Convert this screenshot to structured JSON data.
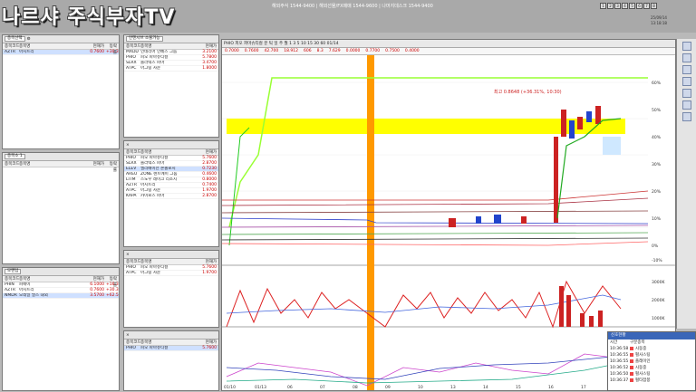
{
  "brand": "나르샤 주식부자TV",
  "ticker": "해외주식 1544-9400 | 해외선물/FX매매 1544-9600 | 나머지데스크 1544-9400",
  "window_buttons": [
    "1",
    "2",
    "3",
    "4",
    "5",
    "6",
    "7",
    "8"
  ],
  "clock": {
    "date": "25/09/14",
    "time": "13:18:18"
  },
  "panel1": {
    "code": "종목선택",
    "cols": [
      "종목코드",
      "종목명",
      "현재가",
      "등락률"
    ],
    "rows": [
      {
        "code": "AZTR",
        "name": "아지트리",
        "price": "0.7600",
        "chg": "+30.3"
      }
    ]
  },
  "panel2": {
    "code": "인텐시브 소울가능",
    "cols": [
      "종목코드",
      "종목명",
      "현재가"
    ],
    "rows": [
      {
        "code": "MXDD",
        "name": "인테리어 인베스 그룹",
        "price": "3.2100"
      },
      {
        "code": "PHIO",
        "name": "피오 파마슈티컬",
        "price": "5.7800"
      },
      {
        "code": "SLRX",
        "name": "솔라텍스 파마",
        "price": "3.4700"
      },
      {
        "code": "ATPC",
        "name": "아그링 사운",
        "price": "1.8000"
      }
    ]
  },
  "panel3": {
    "code": "종목소 1",
    "cols": [
      "종목코드",
      "종목명",
      "현재가",
      "등락률"
    ],
    "rows": []
  },
  "panel4": {
    "cols": [
      "종목코드",
      "종목명",
      "현재가"
    ],
    "rows": [
      {
        "code": "PHIO",
        "name": "피오 파마슈티컬",
        "price": "5.7600"
      },
      {
        "code": "SLRX",
        "name": "솔라텍스 파마",
        "price": "2.8700"
      },
      {
        "code": "ELEV",
        "name": "엘리베이션 온콜로지",
        "price": "0.7230"
      },
      {
        "code": "AREU",
        "name": "ZONE 렌트에이 그룹",
        "price": "0.4600"
      },
      {
        "code": "LITM",
        "name": "스노우 레이크 리소시",
        "price": "0.8000"
      },
      {
        "code": "AZTR",
        "name": "아지트리",
        "price": "0.7400"
      },
      {
        "code": "ATPC",
        "name": "아그링 사운",
        "price": "1.9700"
      },
      {
        "code": "KAPA",
        "name": "카이로스 파마",
        "price": "2.8700"
      }
    ]
  },
  "panel5": {
    "code": "모멘텀",
    "cols": [
      "종목코드",
      "종목명",
      "현재가",
      "등락률"
    ],
    "rows": [
      {
        "code": "PHIN",
        "name": "피에이",
        "price": "6.1000",
        "chg": "+16.3"
      },
      {
        "code": "AZTR",
        "name": "아지트리",
        "price": "0.7600",
        "chg": "+30.3"
      },
      {
        "code": "NMDR",
        "name": "오레일 멀스 내외",
        "price": "3.5700",
        "chg": "+62.5"
      }
    ]
  },
  "panel6": {
    "cols": [
      "종목코드",
      "종목명",
      "현재가"
    ],
    "rows": [
      {
        "code": "PHIO",
        "name": "피오 파마슈티컬",
        "price": "5.7600"
      },
      {
        "code": "ATPC",
        "name": "아그링 사운",
        "price": "1.9700"
      }
    ]
  },
  "panel7": {
    "cols": [
      "종목코드",
      "종목명",
      "현재가"
    ],
    "rows": [
      {
        "code": "PHIO",
        "name": "피오 파마슈티컬",
        "price": "5.7600"
      }
    ]
  },
  "chart": {
    "symbol": "PHIO",
    "toolbar": "PHIO 피오 파마슈티컬  분 틱 일 주 월  1 3 5 10 15 30 60  01/14",
    "info": [
      "0.7000",
      "0.7600",
      "42.700",
      "18.912",
      "606",
      "8.3",
      "7.629",
      "0.0000",
      "0.7700",
      "0.7500",
      "0.4000"
    ],
    "peak_label": "최고 0.8648 (+36.31%, 10:30)",
    "axis_pct": [
      "60%",
      "50%",
      "40%",
      "30%",
      "20%",
      "10%",
      "0%",
      "-10%"
    ],
    "vol_axis": [
      "3000K",
      "2000K",
      "1000K"
    ],
    "dates": [
      "01/10",
      "01/13",
      "06",
      "07",
      "08",
      "09",
      "10",
      "13",
      "14",
      "15",
      "16",
      "17",
      "20"
    ]
  },
  "signal": {
    "title": "신호현황",
    "cols": [
      "시간",
      "구분",
      "종목"
    ],
    "rows": [
      {
        "time": "10:36:58",
        "name": "시동중"
      },
      {
        "time": "10:36:55",
        "name": "펄사스팅"
      },
      {
        "time": "10:36:55",
        "name": "플레이인"
      },
      {
        "time": "10:36:52",
        "name": "시동중"
      },
      {
        "time": "10:36:50",
        "name": "펄사스팅"
      },
      {
        "time": "10:36:37",
        "name": "펄타잡봉"
      }
    ]
  }
}
